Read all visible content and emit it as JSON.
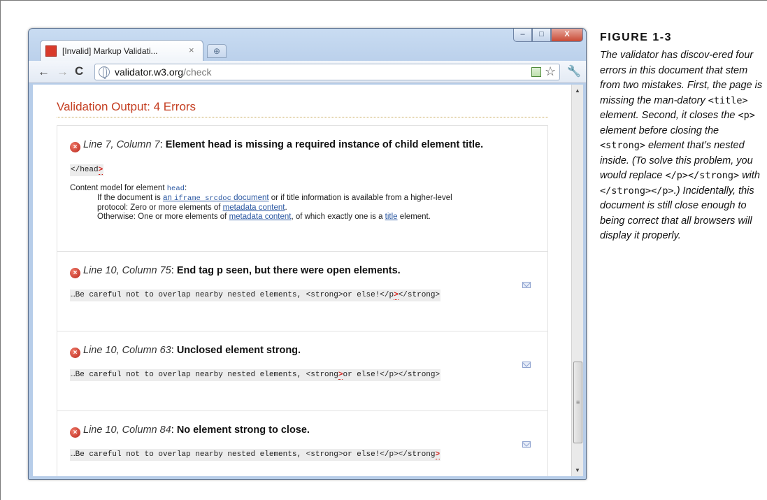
{
  "browser": {
    "tab_title": "[Invalid] Markup Validati...",
    "tab_close": "×",
    "new_tab": "⊕",
    "window_buttons": {
      "minimize": "–",
      "maximize": "□",
      "close": "X"
    },
    "url_host": "validator.w3.org",
    "url_path": "/check",
    "nav": {
      "back": "←",
      "forward": "→",
      "reload": "C"
    }
  },
  "page": {
    "heading": "Validation Output: 4 Errors",
    "errors": [
      {
        "location": "Line 7, Column 7",
        "message": "Element head is missing a required instance of child element title.",
        "code_before": "</head",
        "code_marker": ">",
        "code_after": "",
        "content_model": {
          "intro": "Content model for element ",
          "element": "head",
          "intro_end": ":",
          "line1_a": "If the document is ",
          "line1_link1": "an ",
          "line1_link_code": "iframe srcdoc",
          "line1_link2": " document",
          "line1_b": " or if title information is available from a higher-level",
          "line2_a": "protocol: Zero or more elements of ",
          "line2_link": "metadata content",
          "line2_b": ".",
          "line3_a": "Otherwise: One or more elements of ",
          "line3_link1": "metadata content",
          "line3_b": ", of which exactly one is a ",
          "line3_link2": "title",
          "line3_c": " element."
        }
      },
      {
        "location": "Line 10, Column 75",
        "message": "End tag p seen, but there were open elements.",
        "code_before": "…Be careful not to overlap nearby nested elements, <strong>or else!</p",
        "code_marker": ">",
        "code_after": "</strong>"
      },
      {
        "location": "Line 10, Column 63",
        "message": "Unclosed element strong.",
        "code_before": "…Be careful not to overlap nearby nested elements, <strong",
        "code_marker": ">",
        "code_after": "or else!</p></strong>"
      },
      {
        "location": "Line 10, Column 84",
        "message": "No element strong to close.",
        "code_before": "…Be careful not to overlap nearby nested elements, <strong>or else!</p></strong",
        "code_marker": ">",
        "code_after": ""
      }
    ]
  },
  "caption": {
    "label": "FIGURE 1-3",
    "p1": "The validator has discov-ered four errors in this document that stem from two mistakes. First, the page is missing the man-datory ",
    "c1": "<title>",
    "p2": " element. Second, it closes the ",
    "c2": "<p>",
    "p3": " element before closing the ",
    "c3": "<strong>",
    "p4": " element that’s nested inside. (To solve this problem, you would replace ",
    "c4": "</p></strong>",
    "p5": " with ",
    "c5": "</strong></p>",
    "p6": ".) Incidentally, this document is still close enough to being correct that all browsers will display it properly."
  },
  "colors": {
    "heading": "#c43d20",
    "error_marker": "#d2211a",
    "link": "#2e5aa3"
  },
  "icons": {
    "error": "error-icon",
    "mail": "mail-icon",
    "star": "star-icon",
    "wrench": "wrench-icon",
    "globe": "globe-icon"
  }
}
